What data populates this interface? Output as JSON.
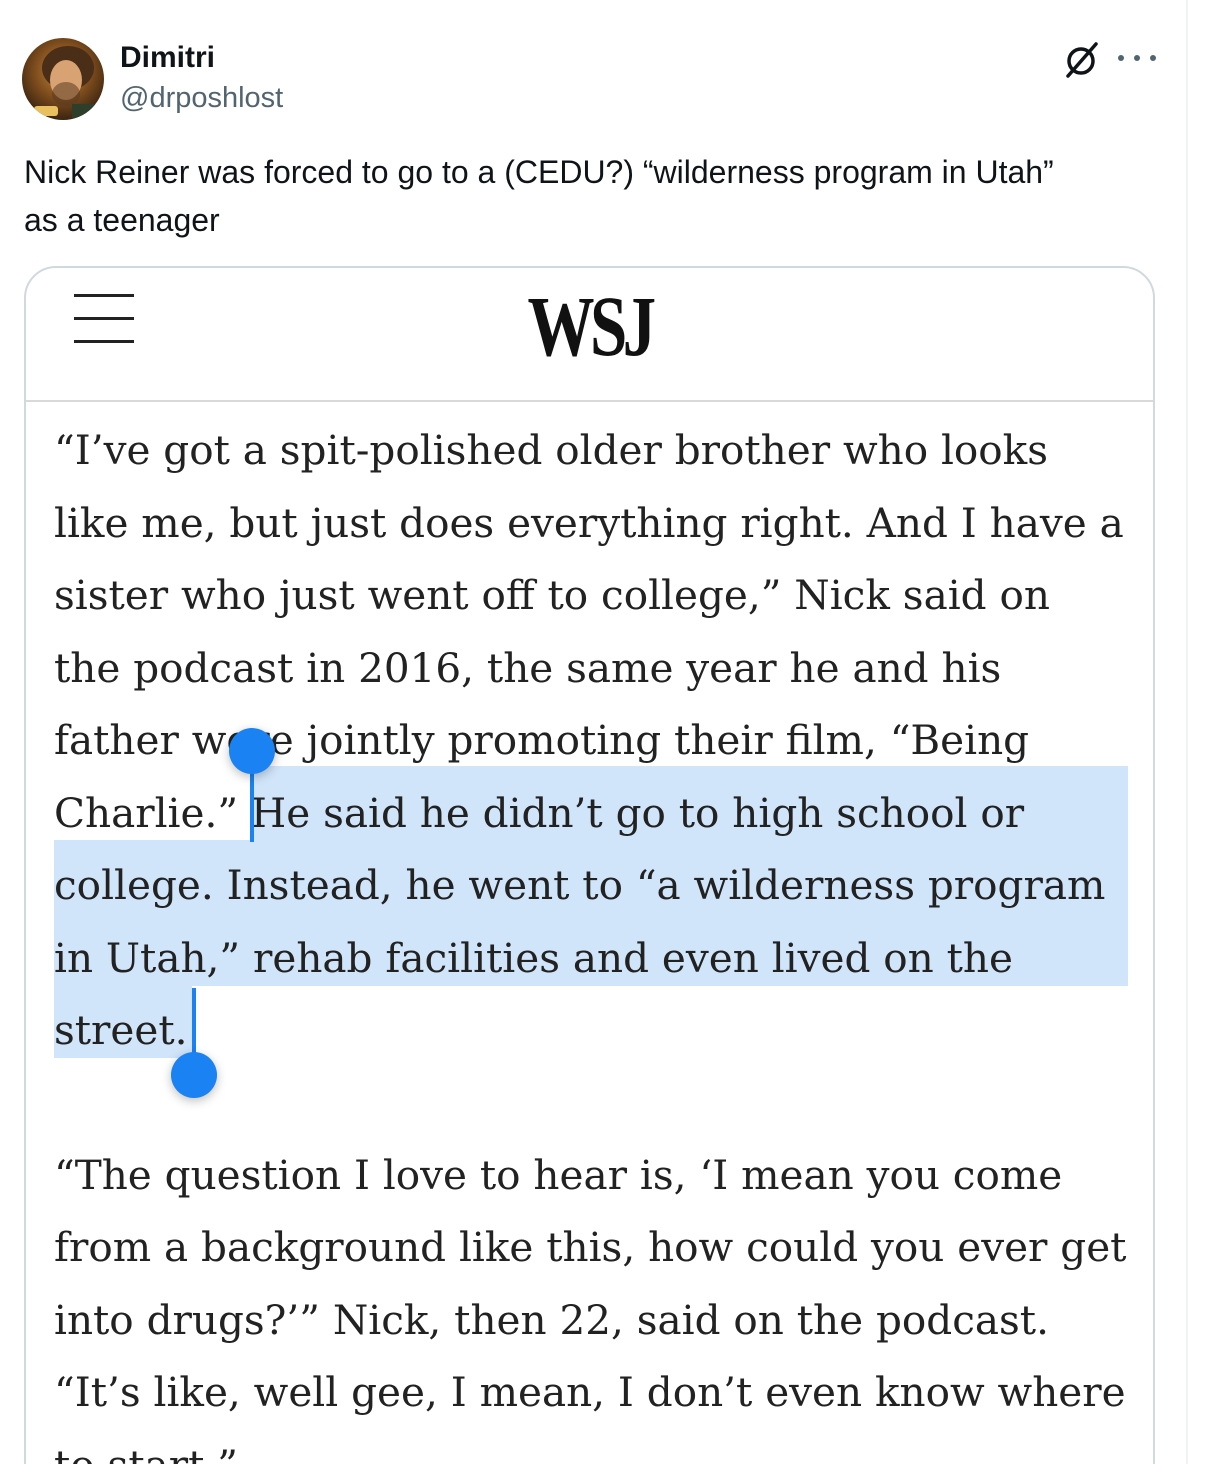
{
  "tweet": {
    "author_name": "Dimitri",
    "author_handle": "@drposhlost",
    "text_line1": "Nick Reiner was forced to go to a (CEDU?) “wilderness program in Utah”",
    "text_line2": "as a teenager",
    "icons": {
      "grok": "grok-icon",
      "more": "more-icon"
    }
  },
  "media": {
    "logo": "WSJ",
    "menu_icon": "hamburger-menu-icon",
    "paragraph1_lines": [
      "“I’ve got a spit-polished older brother who looks",
      "like me, but just does everything right. And I have a",
      "sister who just went off to college,” Nick said on",
      "the podcast in 2016, the same year he and his",
      "father were jointly promoting their film, “Being",
      "Charlie.” He said he didn’t go to high school or",
      "college. Instead, he went to “a wilderness program",
      "in Utah,” rehab facilities and even lived on the",
      "street."
    ],
    "paragraph2_lines": [
      "“The question I love to hear is, ‘I mean you come",
      "from a background like this, how could you ever get",
      "into drugs?’” Nick, then 22, said on the podcast.",
      "“It’s like, well gee, I mean, I don’t even know where",
      "to start.”"
    ],
    "selected_text": "He said he didn’t go to high school or college. Instead, he went to “a wilderness program in Utah,” rehab facilities and even lived on the street."
  },
  "colors": {
    "selection": "#c6dcf8",
    "selection_handle": "#1a82f2",
    "card_border": "#cfd9de",
    "handle_text": "#536471"
  }
}
